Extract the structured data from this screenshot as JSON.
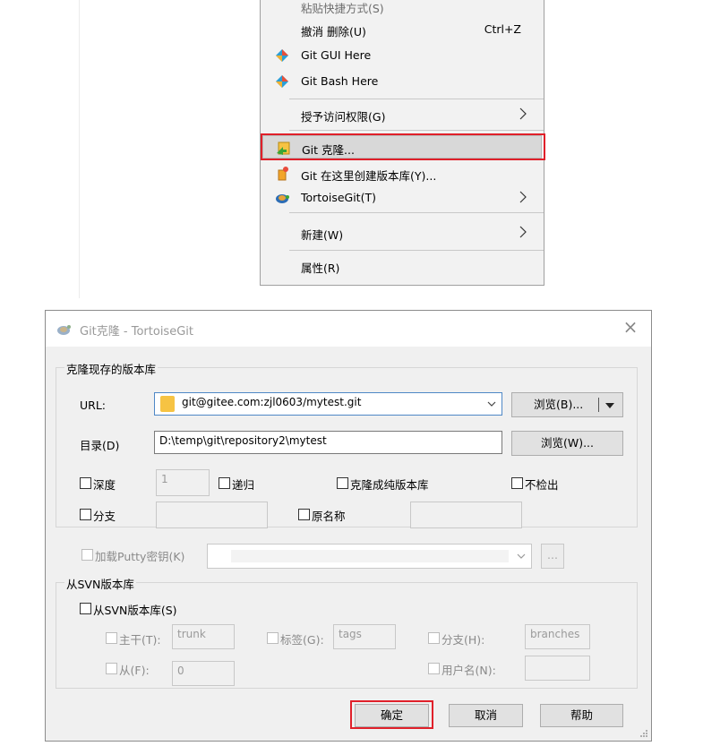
{
  "context_menu": {
    "items": [
      {
        "label": "粘贴快捷方式(S)"
      },
      {
        "label": "撤消 删除(U)",
        "shortcut": "Ctrl+Z"
      },
      {
        "label": "Git GUI Here",
        "icon": "git-diamond-icon"
      },
      {
        "label": "Git Bash Here",
        "icon": "git-diamond-icon"
      },
      {
        "label": "授予访问权限(G)"
      },
      {
        "label": "Git 克隆...",
        "icon": "tortoisegit-clone-icon"
      },
      {
        "label": "Git 在这里创建版本库(Y)...",
        "icon": "tortoisegit-create-repo-icon"
      },
      {
        "label": "TortoiseGit(T)",
        "icon": "tortoisegit-turtle-icon"
      },
      {
        "label": "新建(W)"
      },
      {
        "label": "属性(R)"
      }
    ],
    "highlight_color": "#e0202a"
  },
  "dialog": {
    "title": "Git克隆 - TortoiseGit",
    "clone_group": {
      "title": "克隆现存的版本库",
      "url_label": "URL:",
      "url_value": "git@gitee.com:zjl0603/mytest.git",
      "browse_url": "浏览(B)...",
      "dir_label": "目录(D)",
      "dir_value": "D:\\temp\\git\\repository2\\mytest",
      "browse_dir": "浏览(W)...",
      "depth_label": "深度",
      "depth_value": "1",
      "recursive_label": "递归",
      "bare_label": "克隆成纯版本库",
      "no_checkout_label": "不检出",
      "branch_label": "分支",
      "origin_label": "原名称"
    },
    "putty": {
      "label": "加载Putty密钥(K)",
      "browse": "..."
    },
    "svn_group": {
      "title": "从SVN版本库",
      "from_svn_label": "从SVN版本库(S)",
      "trunk_label": "主干(T):",
      "trunk_value": "trunk",
      "tags_label": "标签(G):",
      "tags_value": "tags",
      "branch_label": "分支(H):",
      "branch_value": "branches",
      "from_label": "从(F):",
      "from_value": "0",
      "username_label": "用户名(N):"
    },
    "buttons": {
      "ok": "确定",
      "cancel": "取消",
      "help": "帮助"
    }
  }
}
